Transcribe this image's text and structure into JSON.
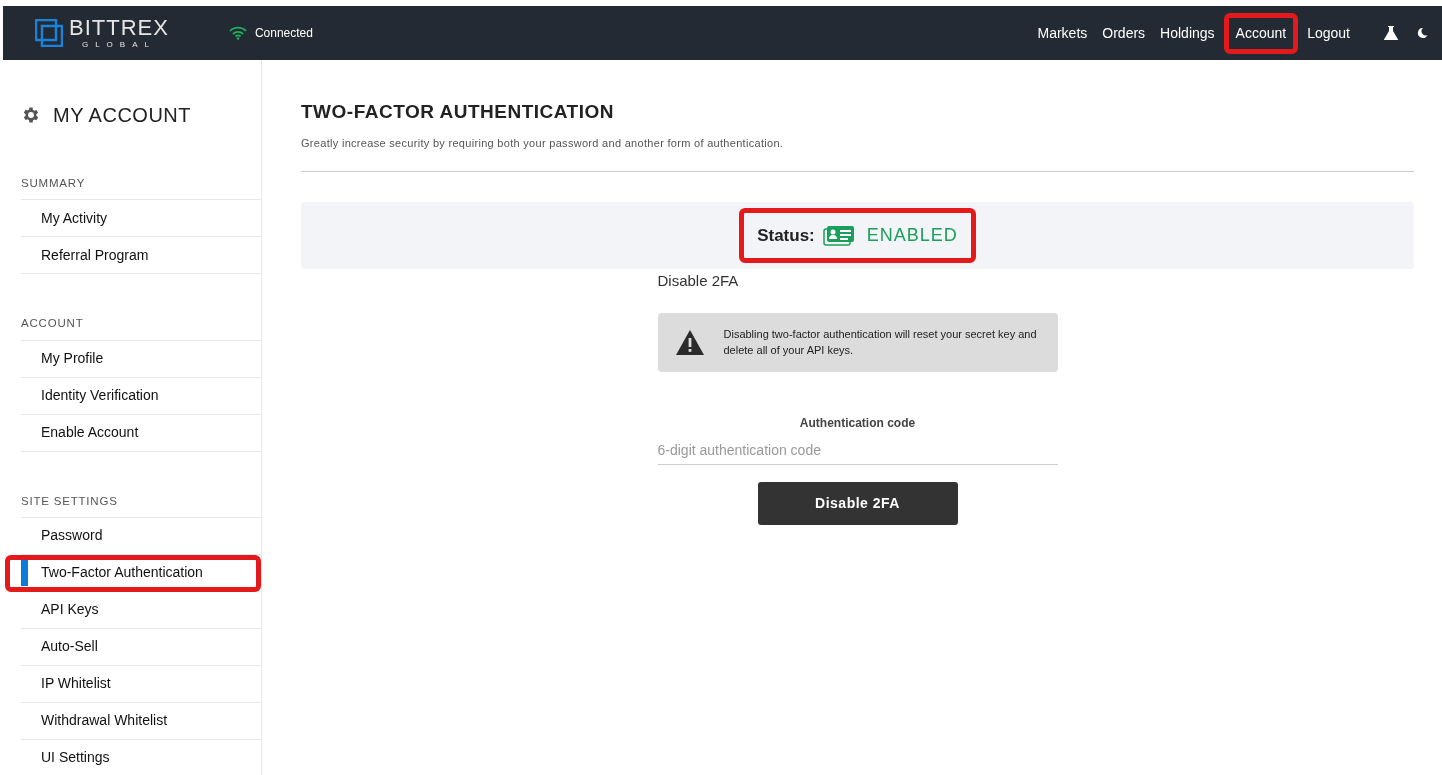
{
  "header": {
    "logo": {
      "name": "BITTREX",
      "sub": "GLOBAL"
    },
    "connection": "Connected",
    "nav": [
      {
        "label": "Markets",
        "highlighted": false
      },
      {
        "label": "Orders",
        "highlighted": false
      },
      {
        "label": "Holdings",
        "highlighted": false
      },
      {
        "label": "Account",
        "highlighted": true
      },
      {
        "label": "Logout",
        "highlighted": false
      }
    ]
  },
  "sidebar": {
    "title": "MY ACCOUNT",
    "sections": [
      {
        "heading": "SUMMARY",
        "items": [
          {
            "label": "My Activity",
            "selected": false,
            "highlighted": false
          },
          {
            "label": "Referral Program",
            "selected": false,
            "highlighted": false
          }
        ]
      },
      {
        "heading": "ACCOUNT",
        "items": [
          {
            "label": "My Profile",
            "selected": false,
            "highlighted": false
          },
          {
            "label": "Identity Verification",
            "selected": false,
            "highlighted": false
          },
          {
            "label": "Enable Account",
            "selected": false,
            "highlighted": false
          }
        ]
      },
      {
        "heading": "SITE SETTINGS",
        "items": [
          {
            "label": "Password",
            "selected": false,
            "highlighted": false
          },
          {
            "label": "Two-Factor Authentication",
            "selected": true,
            "highlighted": true
          },
          {
            "label": "API Keys",
            "selected": false,
            "highlighted": false
          },
          {
            "label": "Auto-Sell",
            "selected": false,
            "highlighted": false
          },
          {
            "label": "IP Whitelist",
            "selected": false,
            "highlighted": false
          },
          {
            "label": "Withdrawal Whitelist",
            "selected": false,
            "highlighted": false
          },
          {
            "label": "UI Settings",
            "selected": false,
            "highlighted": false
          }
        ]
      }
    ]
  },
  "main": {
    "title": "TWO-FACTOR AUTHENTICATION",
    "subtitle": "Greatly increase security by requiring both your password and another form of authentication.",
    "status": {
      "label": "Status:",
      "value": "ENABLED",
      "enabled": true,
      "highlighted": true
    },
    "section_title": "Disable 2FA",
    "warning": "Disabling two-factor authentication will reset your secret key and delete all of your API keys.",
    "code_field": {
      "label": "Authentication code",
      "placeholder": "6-digit authentication code"
    },
    "button": "Disable 2FA"
  }
}
